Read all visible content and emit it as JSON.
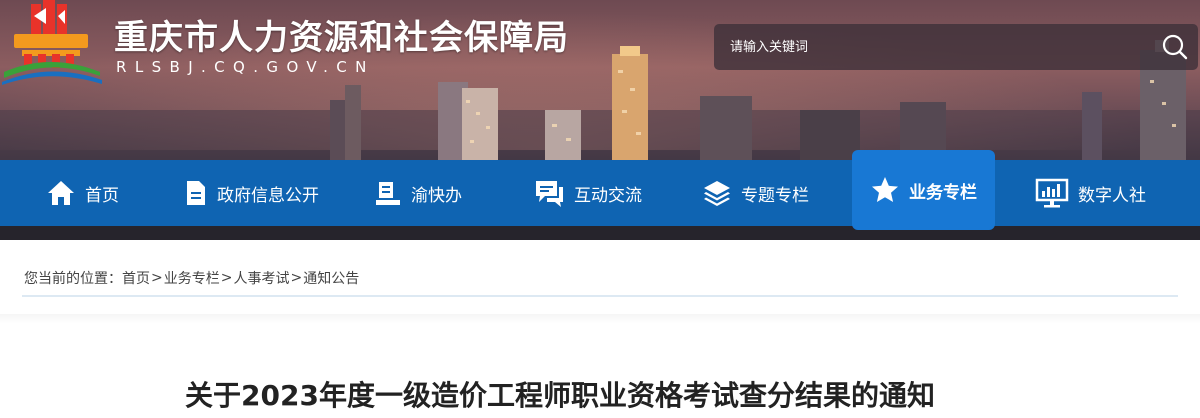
{
  "site": {
    "title": "重庆市人力资源和社会保障局",
    "domain": "RLSBJ.CQ.GOV.CN"
  },
  "search": {
    "placeholder": "请输入关键词"
  },
  "nav": {
    "items": [
      {
        "label": "首页",
        "icon": "home-icon"
      },
      {
        "label": "政府信息公开",
        "icon": "document-icon"
      },
      {
        "label": "渝快办",
        "icon": "service-desk-icon"
      },
      {
        "label": "互动交流",
        "icon": "chat-icon"
      },
      {
        "label": "专题专栏",
        "icon": "layers-icon"
      },
      {
        "label": "业务专栏",
        "icon": "star-icon",
        "active": true
      },
      {
        "label": "数字人社",
        "icon": "monitor-chart-icon"
      }
    ]
  },
  "breadcrumb": {
    "prefix": "您当前的位置：",
    "items": [
      "首页",
      "业务专栏",
      "人事考试",
      "通知公告"
    ],
    "separator": ">"
  },
  "article": {
    "title": "关于2023年度一级造价工程师职业资格考试查分结果的通知"
  },
  "colors": {
    "nav_bg": "#0f64b2",
    "nav_active_bg": "#1878d4",
    "logo_red": "#e8332a",
    "logo_orange": "#f39a1e",
    "logo_green": "#3aa13a",
    "logo_blue": "#1a6fc0"
  }
}
